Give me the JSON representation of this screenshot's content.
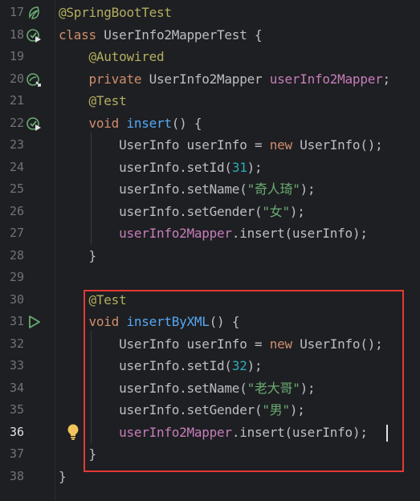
{
  "editor": {
    "language": "Java",
    "active_line": 36,
    "lines": [
      {
        "n": "17",
        "tokens": [
          {
            "t": "@SpringBootTest",
            "c": "ann"
          }
        ]
      },
      {
        "n": "18",
        "tokens": [
          {
            "t": "class ",
            "c": "kw"
          },
          {
            "t": "UserInfo2MapperTest {",
            "c": ""
          }
        ]
      },
      {
        "n": "19",
        "tokens": [
          {
            "t": "    "
          },
          {
            "t": "@Autowired",
            "c": "ann"
          }
        ]
      },
      {
        "n": "20",
        "tokens": [
          {
            "t": "    "
          },
          {
            "t": "private ",
            "c": "kw"
          },
          {
            "t": "UserInfo2Mapper ",
            "c": ""
          },
          {
            "t": "userInfo2Mapper",
            "c": "fld"
          },
          {
            "t": ";",
            "c": ""
          }
        ]
      },
      {
        "n": "21",
        "tokens": [
          {
            "t": "    "
          },
          {
            "t": "@Test",
            "c": "ann"
          }
        ]
      },
      {
        "n": "22",
        "tokens": [
          {
            "t": "    "
          },
          {
            "t": "void ",
            "c": "kw"
          },
          {
            "t": "insert",
            "c": "fn"
          },
          {
            "t": "() {",
            "c": ""
          }
        ]
      },
      {
        "n": "23",
        "tokens": [
          {
            "t": "        "
          },
          {
            "t": "UserInfo userInfo = ",
            "c": ""
          },
          {
            "t": "new ",
            "c": "kw"
          },
          {
            "t": "UserInfo();",
            "c": ""
          }
        ]
      },
      {
        "n": "24",
        "tokens": [
          {
            "t": "        "
          },
          {
            "t": "userInfo.setId(",
            "c": ""
          },
          {
            "t": "31",
            "c": "num"
          },
          {
            "t": ");",
            "c": ""
          }
        ]
      },
      {
        "n": "25",
        "tokens": [
          {
            "t": "        "
          },
          {
            "t": "userInfo.setName(",
            "c": ""
          },
          {
            "t": "\"奇人琦\"",
            "c": "str"
          },
          {
            "t": ");",
            "c": ""
          }
        ]
      },
      {
        "n": "26",
        "tokens": [
          {
            "t": "        "
          },
          {
            "t": "userInfo.setGender(",
            "c": ""
          },
          {
            "t": "\"女\"",
            "c": "str"
          },
          {
            "t": ");",
            "c": ""
          }
        ]
      },
      {
        "n": "27",
        "tokens": [
          {
            "t": "        "
          },
          {
            "t": "userInfo2Mapper",
            "c": "fld"
          },
          {
            "t": ".insert(userInfo);",
            "c": ""
          }
        ]
      },
      {
        "n": "28",
        "tokens": [
          {
            "t": "    "
          },
          {
            "t": "}",
            "c": ""
          }
        ]
      },
      {
        "n": "29",
        "tokens": []
      },
      {
        "n": "30",
        "tokens": [
          {
            "t": "    "
          },
          {
            "t": "@Test",
            "c": "ann"
          }
        ]
      },
      {
        "n": "31",
        "tokens": [
          {
            "t": "    "
          },
          {
            "t": "void ",
            "c": "kw"
          },
          {
            "t": "insertByXML",
            "c": "fn"
          },
          {
            "t": "() {",
            "c": ""
          }
        ]
      },
      {
        "n": "32",
        "tokens": [
          {
            "t": "        "
          },
          {
            "t": "UserInfo userInfo = ",
            "c": ""
          },
          {
            "t": "new ",
            "c": "kw"
          },
          {
            "t": "UserInfo();",
            "c": ""
          }
        ]
      },
      {
        "n": "33",
        "tokens": [
          {
            "t": "        "
          },
          {
            "t": "userInfo.setId(",
            "c": ""
          },
          {
            "t": "32",
            "c": "num"
          },
          {
            "t": ");",
            "c": ""
          }
        ]
      },
      {
        "n": "34",
        "tokens": [
          {
            "t": "        "
          },
          {
            "t": "userInfo.setName(",
            "c": ""
          },
          {
            "t": "\"老大哥\"",
            "c": "str"
          },
          {
            "t": ");",
            "c": ""
          }
        ]
      },
      {
        "n": "35",
        "tokens": [
          {
            "t": "        "
          },
          {
            "t": "userInfo.setGender(",
            "c": ""
          },
          {
            "t": "\"男\"",
            "c": "str"
          },
          {
            "t": ");",
            "c": ""
          }
        ]
      },
      {
        "n": "36",
        "tokens": [
          {
            "t": "        "
          },
          {
            "t": "userInfo2Mapper",
            "c": "fld"
          },
          {
            "t": ".insert(userInfo);",
            "c": ""
          }
        ]
      },
      {
        "n": "37",
        "tokens": [
          {
            "t": "    "
          },
          {
            "t": "}",
            "c": ""
          }
        ]
      },
      {
        "n": "38",
        "tokens": [
          {
            "t": "}",
            "c": ""
          }
        ]
      }
    ],
    "gutter_icons": {
      "17": "spring-bean-icon",
      "18": "run-test-class-icon",
      "20": "spring-autowire-icon",
      "22": "run-test-method-icon",
      "31": "run-icon"
    },
    "intention_icon": "lightbulb-icon",
    "colors": {
      "background": "#1e1f22",
      "keyword": "#cf8e6d",
      "annotation": "#b3ae60",
      "method": "#56a8f5",
      "field": "#c77dbb",
      "number": "#2aacb8",
      "string": "#6aab73",
      "highlight_box": "#e53935"
    }
  }
}
